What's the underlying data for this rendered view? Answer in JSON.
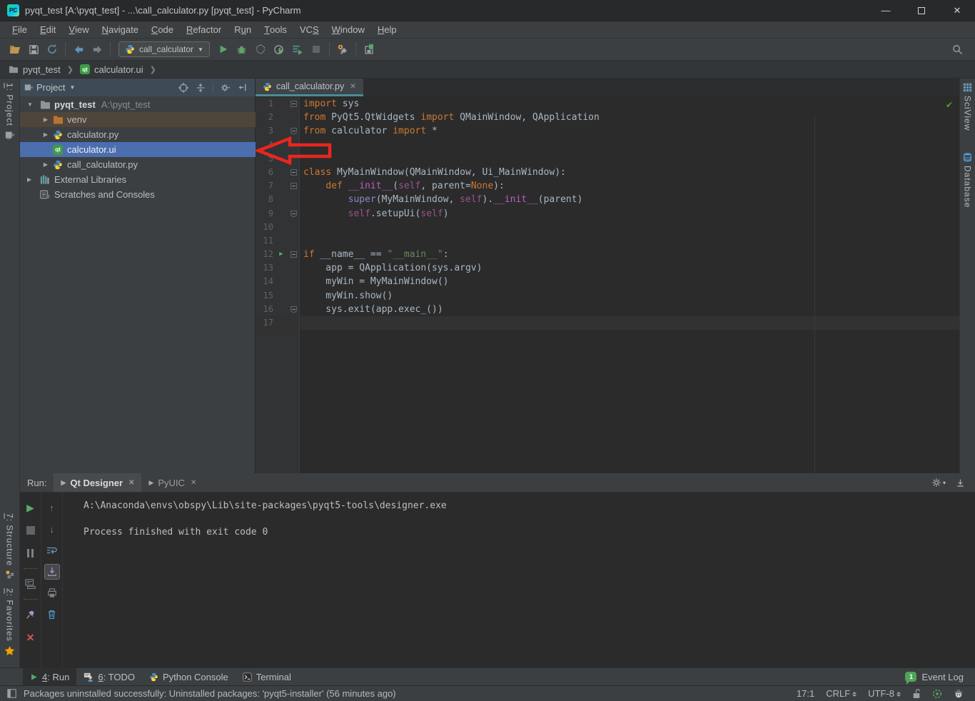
{
  "window": {
    "logo": "PC",
    "title": "pyqt_test [A:\\pyqt_test] - ...\\call_calculator.py [pyqt_test] - PyCharm"
  },
  "menu": {
    "items": [
      {
        "label": "File",
        "m": 0
      },
      {
        "label": "Edit",
        "m": 0
      },
      {
        "label": "View",
        "m": 0
      },
      {
        "label": "Navigate",
        "m": 0
      },
      {
        "label": "Code",
        "m": 0
      },
      {
        "label": "Refactor",
        "m": 0
      },
      {
        "label": "Run",
        "m": 1
      },
      {
        "label": "Tools",
        "m": 0
      },
      {
        "label": "VCS",
        "m": 2
      },
      {
        "label": "Window",
        "m": 0
      },
      {
        "label": "Help",
        "m": 0
      }
    ]
  },
  "toolbar": {
    "run_config": "call_calculator"
  },
  "breadcrumbs": {
    "items": [
      "pyqt_test",
      "calculator.ui"
    ]
  },
  "project": {
    "header": "Project",
    "tree": [
      {
        "label": "pyqt_test",
        "suffix": "A:\\pyqt_test"
      },
      {
        "label": "venv"
      },
      {
        "label": "calculator.py"
      },
      {
        "label": "calculator.ui"
      },
      {
        "label": "call_calculator.py"
      },
      {
        "label": "External Libraries"
      },
      {
        "label": "Scratches and Consoles"
      }
    ]
  },
  "editor": {
    "tab": "call_calculator.py",
    "qt_badge": "qt",
    "lines": [
      {
        "n": "1",
        "f": "open",
        "tk": [
          [
            "k",
            "import"
          ],
          [
            "t",
            " sys"
          ]
        ]
      },
      {
        "n": "2",
        "tk": [
          [
            "k",
            "from"
          ],
          [
            "t",
            " PyQt5.QtWidgets "
          ],
          [
            "k",
            "import"
          ],
          [
            "t",
            " QMainWindow, QApplication"
          ]
        ]
      },
      {
        "n": "3",
        "f": "end",
        "tk": [
          [
            "k",
            "from"
          ],
          [
            "t",
            " calculator "
          ],
          [
            "k",
            "import"
          ],
          [
            "t",
            " *"
          ]
        ]
      },
      {
        "n": "4",
        "tk": []
      },
      {
        "n": "5",
        "tk": []
      },
      {
        "n": "6",
        "f": "open",
        "tk": [
          [
            "k",
            "class"
          ],
          [
            "t",
            " MyMainWindow(QMainWindow, Ui_MainWindow):"
          ]
        ]
      },
      {
        "n": "7",
        "f": "open",
        "tk": [
          [
            "t",
            "    "
          ],
          [
            "k",
            "def"
          ],
          [
            "t",
            " "
          ],
          [
            "m",
            "__init__"
          ],
          [
            "t",
            "("
          ],
          [
            "s",
            "self"
          ],
          [
            "t",
            ", parent="
          ],
          [
            "k",
            "None"
          ],
          [
            "t",
            "):"
          ]
        ]
      },
      {
        "n": "8",
        "tk": [
          [
            "t",
            "        "
          ],
          [
            "b",
            "super"
          ],
          [
            "t",
            "(MyMainWindow, "
          ],
          [
            "s",
            "self"
          ],
          [
            "t",
            ")."
          ],
          [
            "m",
            "__init__"
          ],
          [
            "t",
            "(parent)"
          ]
        ]
      },
      {
        "n": "9",
        "f": "end",
        "tk": [
          [
            "t",
            "        "
          ],
          [
            "s",
            "self"
          ],
          [
            "t",
            ".setupUi("
          ],
          [
            "s",
            "self"
          ],
          [
            "t",
            ")"
          ]
        ]
      },
      {
        "n": "10",
        "tk": []
      },
      {
        "n": "11",
        "tk": []
      },
      {
        "n": "12",
        "f": "open",
        "r": true,
        "tk": [
          [
            "k",
            "if"
          ],
          [
            "t",
            " __name__ == "
          ],
          [
            "g",
            "\"__main__\""
          ],
          [
            "t",
            ":"
          ]
        ]
      },
      {
        "n": "13",
        "tk": [
          [
            "t",
            "    app = QApplication(sys.argv)"
          ]
        ]
      },
      {
        "n": "14",
        "tk": [
          [
            "t",
            "    myWin = MyMainWindow()"
          ]
        ]
      },
      {
        "n": "15",
        "tk": [
          [
            "t",
            "    myWin.show()"
          ]
        ]
      },
      {
        "n": "16",
        "f": "end",
        "tk": [
          [
            "t",
            "    sys.exit(app.exec_())"
          ]
        ]
      },
      {
        "n": "17",
        "caret": true,
        "tk": []
      }
    ]
  },
  "run_panel": {
    "label": "Run:",
    "tabs": [
      {
        "label": "Qt Designer"
      },
      {
        "label": "PyUIC"
      }
    ],
    "console": [
      "A:\\Anaconda\\envs\\obspy\\Lib\\site-packages\\pyqt5-tools\\designer.exe",
      "",
      "Process finished with exit code 0"
    ]
  },
  "bottom_bar": {
    "buttons": [
      {
        "label": "4: Run",
        "m": 0
      },
      {
        "label": "6: TODO",
        "m": 0
      },
      {
        "label": "Python Console"
      },
      {
        "label": "Terminal"
      }
    ],
    "event_log": "Event Log",
    "event_badge": "1"
  },
  "status_bar": {
    "message": "Packages uninstalled successfully: Uninstalled packages: 'pyqt5-installer' (56 minutes ago)",
    "caret": "17:1",
    "line_separator": "CRLF",
    "encoding": "UTF-8"
  },
  "strips": {
    "left_top": {
      "label": "1: Project",
      "m": 0
    },
    "left_bottom": [
      {
        "label": "7: Structure",
        "m": 0
      },
      {
        "label": "2: Favorites",
        "m": 0
      }
    ],
    "right": [
      {
        "label": "SciView"
      },
      {
        "label": "Database"
      }
    ]
  },
  "colors": {
    "selection_blue": "#4b6eaf",
    "tab_underline_teal": "#4d8a94",
    "keyword_orange": "#cc7832",
    "string_green": "#6a8759",
    "self_purple": "#94558d",
    "magic_pink": "#bd5ebd",
    "builtin_blue": "#8888c6",
    "run_green": "#59a869",
    "annotation_arrow_red": "#e8261f",
    "event_log_green": "#4fa557"
  }
}
